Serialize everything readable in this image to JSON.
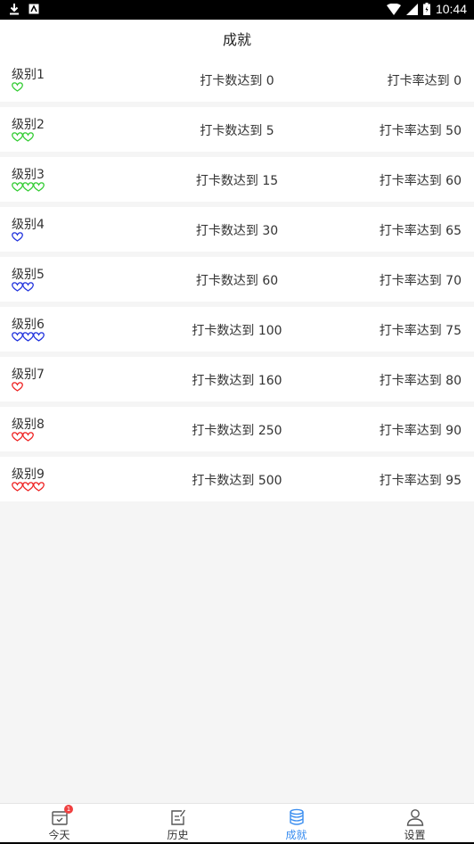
{
  "status": {
    "time": "10:44"
  },
  "header": {
    "title": "成就"
  },
  "colors": {
    "green": "#33cc33",
    "blue": "#2233dd",
    "red": "#ee2222",
    "accent": "#3b8ef0"
  },
  "levels": [
    {
      "name": "级别1",
      "hearts": 1,
      "color": "green",
      "checkins": "打卡数达到 0",
      "rate": "打卡率达到 0"
    },
    {
      "name": "级别2",
      "hearts": 2,
      "color": "green",
      "checkins": "打卡数达到 5",
      "rate": "打卡率达到 50"
    },
    {
      "name": "级别3",
      "hearts": 3,
      "color": "green",
      "checkins": "打卡数达到 15",
      "rate": "打卡率达到 60"
    },
    {
      "name": "级别4",
      "hearts": 1,
      "color": "blue",
      "checkins": "打卡数达到 30",
      "rate": "打卡率达到 65"
    },
    {
      "name": "级别5",
      "hearts": 2,
      "color": "blue",
      "checkins": "打卡数达到 60",
      "rate": "打卡率达到 70"
    },
    {
      "name": "级别6",
      "hearts": 3,
      "color": "blue",
      "checkins": "打卡数达到 100",
      "rate": "打卡率达到 75"
    },
    {
      "name": "级别7",
      "hearts": 1,
      "color": "red",
      "checkins": "打卡数达到 160",
      "rate": "打卡率达到 80"
    },
    {
      "name": "级别8",
      "hearts": 2,
      "color": "red",
      "checkins": "打卡数达到 250",
      "rate": "打卡率达到 90"
    },
    {
      "name": "级别9",
      "hearts": 3,
      "color": "red",
      "checkins": "打卡数达到 500",
      "rate": "打卡率达到 95"
    }
  ],
  "tabbar": {
    "today": {
      "label": "今天",
      "icon": "calendar-check-icon",
      "badge": "1"
    },
    "history": {
      "label": "历史",
      "icon": "notepad-edit-icon"
    },
    "achievements": {
      "label": "成就",
      "icon": "coin-stack-icon"
    },
    "settings": {
      "label": "设置",
      "icon": "person-icon"
    }
  }
}
